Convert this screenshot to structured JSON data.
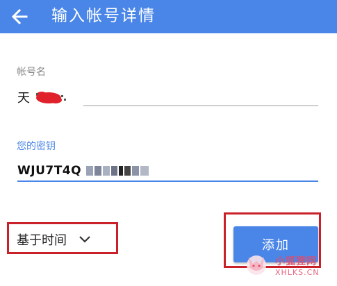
{
  "header": {
    "title": "输入帐号详情",
    "back_icon": "arrow-left-icon",
    "background": "#4a86e8"
  },
  "form": {
    "account_name": {
      "label": "帐号名",
      "value": "天"
    },
    "secret_key": {
      "label": "您的密钥",
      "value": "WJU7T4Q"
    },
    "key_type": {
      "selected": "基于时间",
      "icon": "chevron-down-icon"
    },
    "add_button_label": "添加"
  },
  "watermark": {
    "line1": "小狐狸网",
    "line2": "XHLKS.CN"
  },
  "colors": {
    "accent": "#4a86e8",
    "highlight": "#c9202a"
  }
}
